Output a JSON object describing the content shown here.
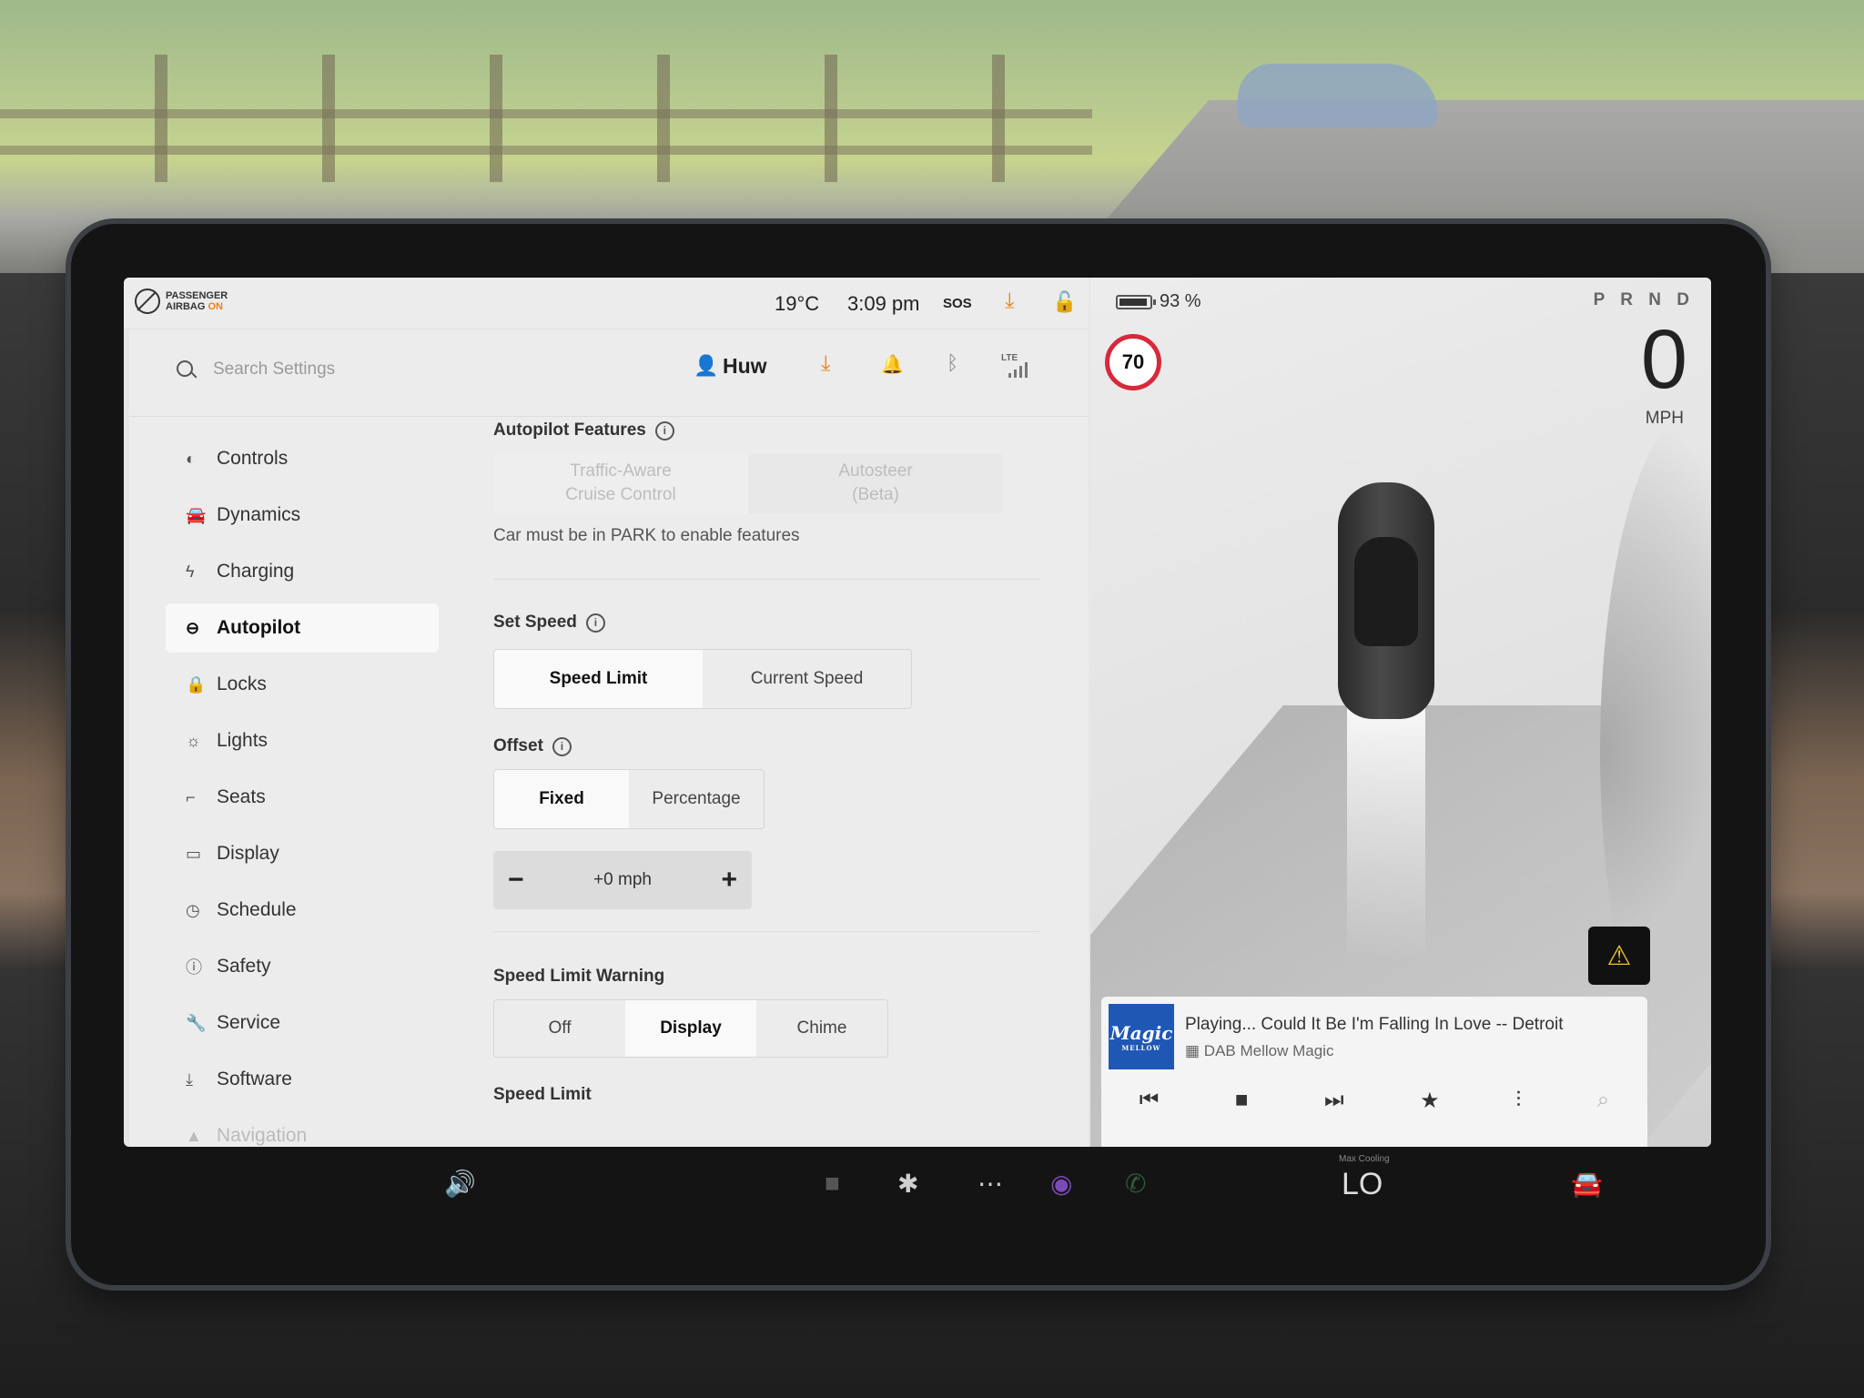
{
  "status": {
    "airbag_line1": "PASSENGER",
    "airbag_line2": "AIRBAG",
    "airbag_state": "ON",
    "temperature": "19°C",
    "time": "3:09 pm",
    "sos": "SOS"
  },
  "top": {
    "search_placeholder": "Search Settings",
    "user": "Huw",
    "network": "LTE"
  },
  "nav": {
    "items": [
      {
        "label": "Controls",
        "icon": "toggle-icon"
      },
      {
        "label": "Dynamics",
        "icon": "car-icon"
      },
      {
        "label": "Charging",
        "icon": "bolt-icon"
      },
      {
        "label": "Autopilot",
        "icon": "steering-wheel-icon"
      },
      {
        "label": "Locks",
        "icon": "lock-icon"
      },
      {
        "label": "Lights",
        "icon": "sun-icon"
      },
      {
        "label": "Seats",
        "icon": "seat-icon"
      },
      {
        "label": "Display",
        "icon": "display-icon"
      },
      {
        "label": "Schedule",
        "icon": "clock-icon"
      },
      {
        "label": "Safety",
        "icon": "alert-circle-icon"
      },
      {
        "label": "Service",
        "icon": "wrench-icon"
      },
      {
        "label": "Software",
        "icon": "download-icon"
      },
      {
        "label": "Navigation",
        "icon": "nav-arrow-icon"
      }
    ]
  },
  "autopilot": {
    "features_title": "Autopilot Features",
    "tacc_line1": "Traffic-Aware",
    "tacc_line2": "Cruise Control",
    "autosteer_line1": "Autosteer",
    "autosteer_line2": "(Beta)",
    "park_note": "Car must be in PARK to enable features",
    "set_speed_title": "Set Speed",
    "set_speed_options": [
      "Speed Limit",
      "Current Speed"
    ],
    "set_speed_selected": "Speed Limit",
    "offset_title": "Offset",
    "offset_options": [
      "Fixed",
      "Percentage"
    ],
    "offset_selected": "Fixed",
    "offset_value": "+0 mph",
    "warning_title": "Speed Limit Warning",
    "warning_options": [
      "Off",
      "Display",
      "Chime"
    ],
    "warning_selected": "Display",
    "speed_limit_title": "Speed Limit"
  },
  "drive": {
    "battery_percent": "93 %",
    "battery_level": 0.93,
    "gears": "P R N D",
    "speed": "0",
    "speed_unit": "MPH",
    "speed_limit_sign": "70"
  },
  "media": {
    "logo_text": "Magic",
    "logo_sub": "MELLOW",
    "title": "Playing... Could It Be I'm Falling In Love -- Detroit",
    "source": "DAB Mellow Magic"
  },
  "climate": {
    "label": "Max Cooling",
    "temp": "LO"
  }
}
